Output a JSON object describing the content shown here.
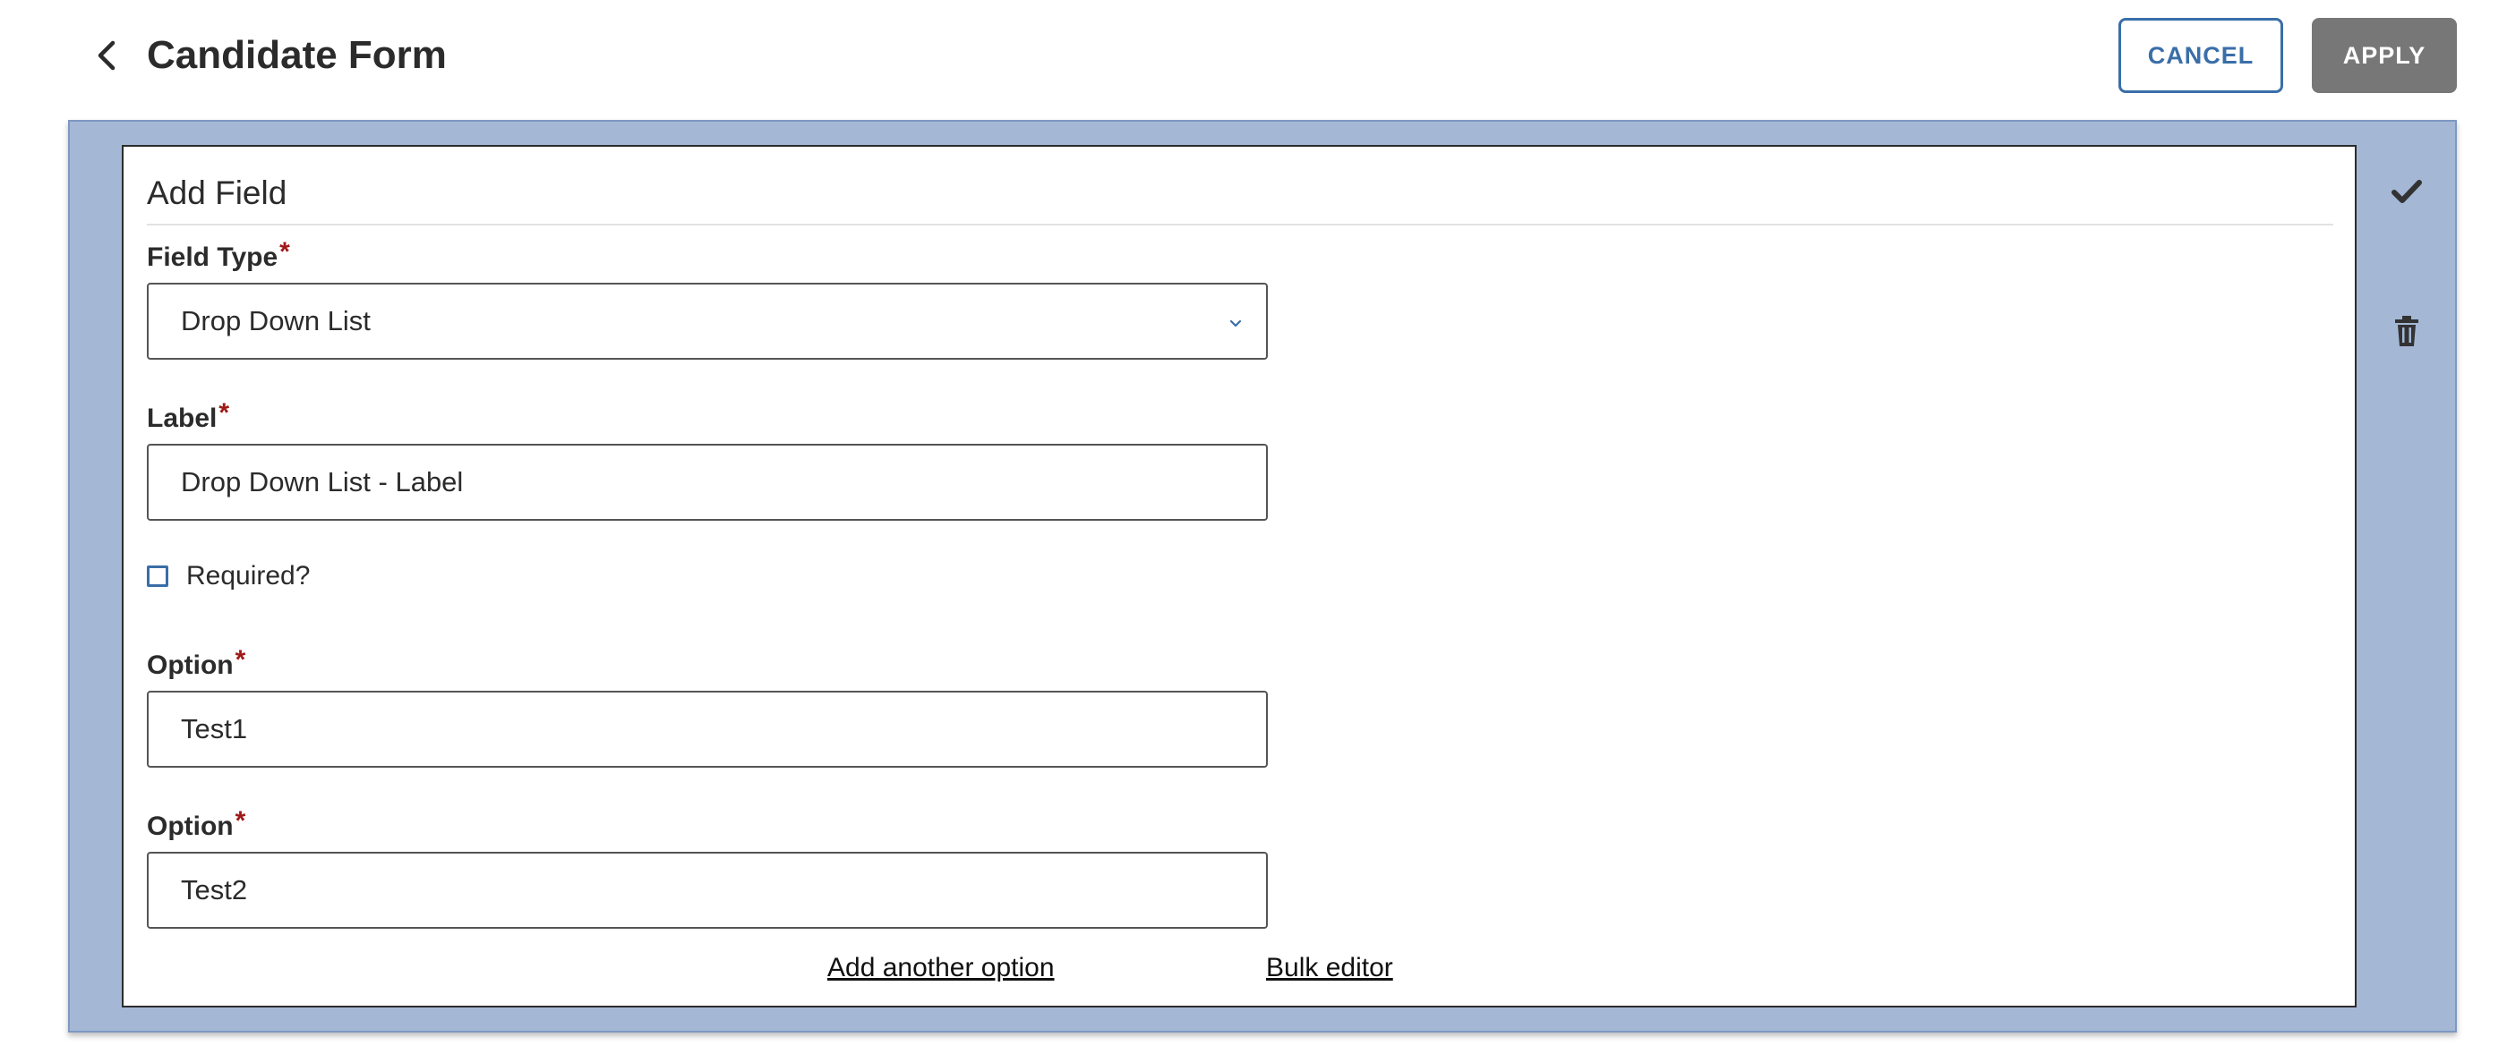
{
  "header": {
    "title": "Candidate Form",
    "cancel_label": "CANCEL",
    "apply_label": "APPLY"
  },
  "card": {
    "title": "Add Field",
    "field_type": {
      "label": "Field Type",
      "required_mark": "*",
      "value": "Drop Down List"
    },
    "label_field": {
      "label": "Label",
      "required_mark": "*",
      "value": "Drop Down List - Label"
    },
    "required_checkbox": {
      "label": "Required?",
      "checked": false
    },
    "options": [
      {
        "label": "Option",
        "required_mark": "*",
        "value": "Test1"
      },
      {
        "label": "Option",
        "required_mark": "*",
        "value": "Test2"
      }
    ],
    "add_option_link": "Add another option",
    "bulk_editor_link": "Bulk editor"
  },
  "icons": {
    "back": "chevron-left-icon",
    "confirm": "check-icon",
    "delete": "trash-icon",
    "dropdown": "chevron-down-icon"
  },
  "colors": {
    "accent": "#3a6ea8",
    "panel_bg": "#a4b8d6",
    "apply_bg": "#777777",
    "required": "#a01818"
  }
}
